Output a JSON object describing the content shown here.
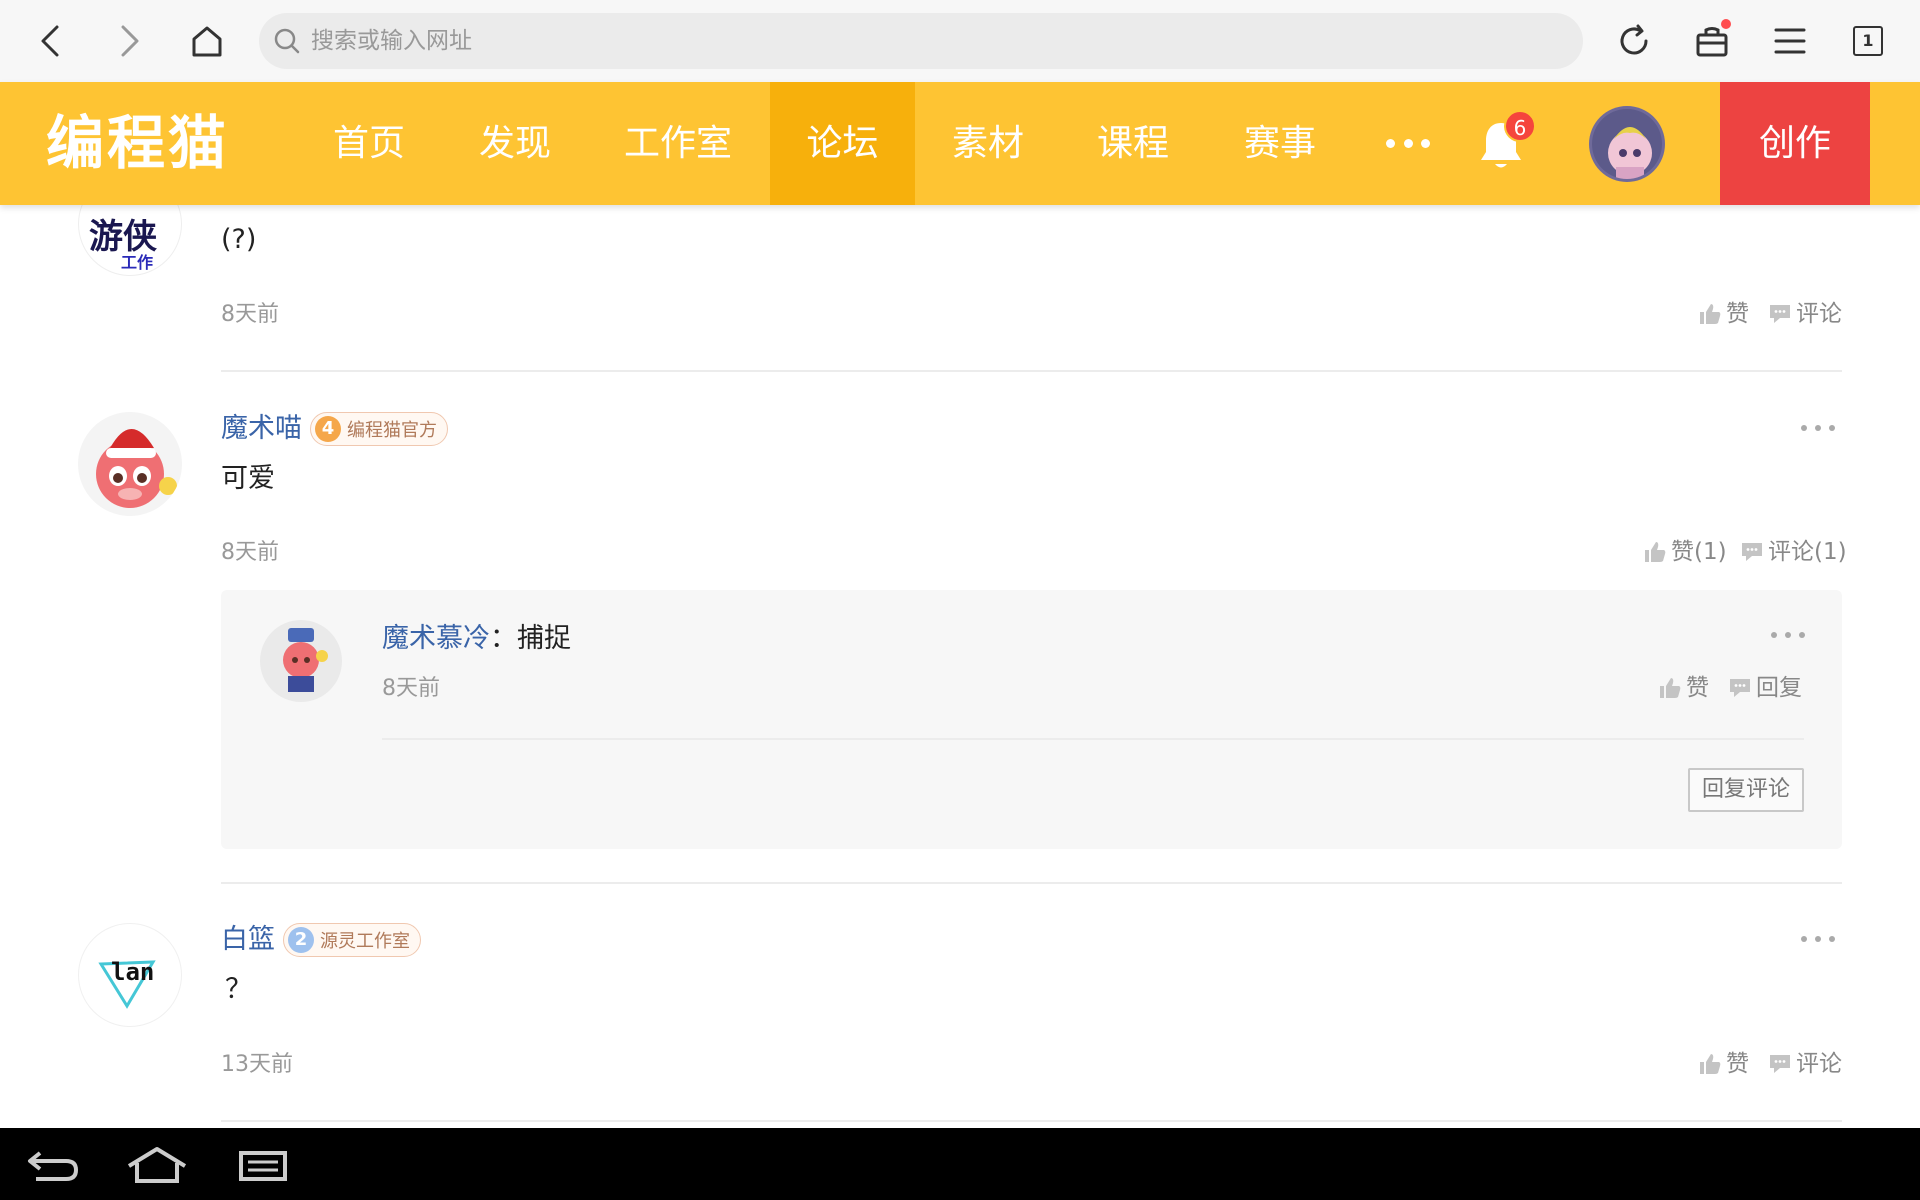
{
  "browser": {
    "search_placeholder": "搜索或输入网址",
    "tab_count": "1",
    "icons": [
      "back-icon",
      "forward-icon",
      "home-icon",
      "search-icon",
      "refresh-icon",
      "gift-icon",
      "menu-icon",
      "tabs-icon"
    ]
  },
  "nav": {
    "logo": "编程猫",
    "items": [
      "首页",
      "发现",
      "工作室",
      "论坛",
      "素材",
      "课程",
      "赛事"
    ],
    "active_item": "论坛",
    "notification_count": "6",
    "create_label": "创作"
  },
  "comments": [
    {
      "text": "(?)",
      "time": "8天前",
      "like_label": "赞",
      "comment_label": "评论"
    },
    {
      "username": "魔术喵",
      "badge_level": "4",
      "badge_text": "编程猫官方",
      "text": "可爱",
      "time": "8天前",
      "like_label": "赞(1)",
      "comment_label": "评论(1)",
      "reply": {
        "username": "魔术慕冷",
        "separator": "：",
        "text": "捕捉",
        "time": "8天前",
        "like_label": "赞",
        "reply_label": "回复",
        "reply_comment_button": "回复评论"
      }
    },
    {
      "username": "白篮",
      "badge_level": "2",
      "badge_text": "源灵工作室",
      "text": "？",
      "time": "13天前",
      "like_label": "赞",
      "comment_label": "评论",
      "avatar_text": "lan"
    }
  ],
  "avatar_text_top": "游侠",
  "avatar_text_top_sub": "工作",
  "colors": {
    "nav_bg": "#fec433",
    "nav_active": "#f7b00c",
    "create_bg": "#ed4341",
    "username": "#3a64a8",
    "badge_bg": "#ea6e4b"
  }
}
